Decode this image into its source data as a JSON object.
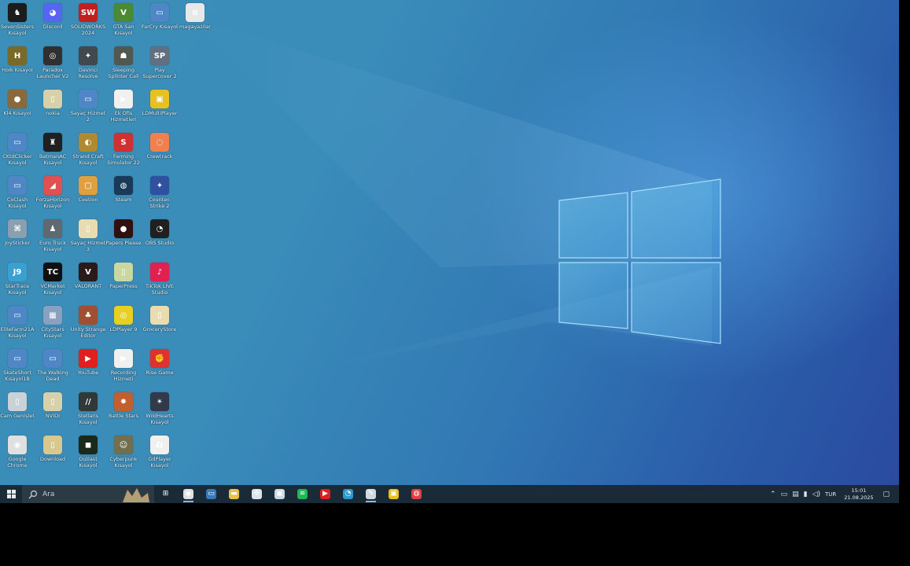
{
  "desktop": {
    "columns": [
      [
        {
          "label": "SevenSisters Kısayol",
          "color": "#1c1c1c",
          "glyph": "♞"
        },
        {
          "label": "Hoik Kısayol",
          "color": "#7a6a2a",
          "glyph": "H"
        },
        {
          "label": "Kl4 Kısayol",
          "color": "#8a6a3a",
          "glyph": "●"
        },
        {
          "label": "CKtdClicker Kısayol",
          "color": "#4f86c6",
          "glyph": "▭"
        },
        {
          "label": "CoClash Kısayol",
          "color": "#4f86c6",
          "glyph": "▭"
        },
        {
          "label": "JoySticker",
          "color": "#8aa0b0",
          "glyph": "⌘"
        },
        {
          "label": "StarTrace Kısayol",
          "color": "#3aa0d0",
          "glyph": "J9"
        },
        {
          "label": "EliteFarm21A Kısayol",
          "color": "#4f86c6",
          "glyph": "▭"
        },
        {
          "label": "SkateShort Kısayol1B",
          "color": "#4f86c6",
          "glyph": "▭"
        },
        {
          "label": "Cam Genişlet",
          "color": "#c8d2d8",
          "glyph": "▯"
        },
        {
          "label": "Google Chrome",
          "color": "#e0e0e0",
          "glyph": "◉"
        }
      ],
      [
        {
          "label": "Discord",
          "color": "#5865f2",
          "glyph": "◕"
        },
        {
          "label": "Paradox Launcher V2",
          "color": "#303030",
          "glyph": "◎"
        },
        {
          "label": "nokia",
          "color": "#d8d0a8",
          "glyph": "▯"
        },
        {
          "label": "BatmanAC Kısayol",
          "color": "#202020",
          "glyph": "♜"
        },
        {
          "label": "ForzaHorizon Kısayol",
          "color": "#e05050",
          "glyph": "◢"
        },
        {
          "label": "Euro Truck Kısayol",
          "color": "#606870",
          "glyph": "♟"
        },
        {
          "label": "VCMarket Kısayol",
          "color": "#101010",
          "glyph": "TC"
        },
        {
          "label": "CityStars Kısayol",
          "color": "#8aa0c0",
          "glyph": "▦"
        },
        {
          "label": "The Walking Dead",
          "color": "#4f86c6",
          "glyph": "▭"
        },
        {
          "label": "NVIDI",
          "color": "#d8d0a8",
          "glyph": "▯"
        },
        {
          "label": "Download",
          "color": "#d8c890",
          "glyph": "▯"
        }
      ],
      [
        {
          "label": "SOLIDWORKS 2024",
          "color": "#c02020",
          "glyph": "SW"
        },
        {
          "label": "Davinci Resolve",
          "color": "#404850",
          "glyph": "✦"
        },
        {
          "label": "Sayaç Hizmet 2",
          "color": "#4f86c6",
          "glyph": "▭"
        },
        {
          "label": "Strand Craft Kısayol",
          "color": "#b08a30",
          "glyph": "◐"
        },
        {
          "label": "Ceetion",
          "color": "#e0a040",
          "glyph": "▢"
        },
        {
          "label": "Sayaç Hizmet 3",
          "color": "#e8dcb0",
          "glyph": "▯"
        },
        {
          "label": "VALORANT",
          "color": "#2a1a1a",
          "glyph": "V"
        },
        {
          "label": "Unity Strange Editor",
          "color": "#a05030",
          "glyph": "♣"
        },
        {
          "label": "YouTube",
          "color": "#e02020",
          "glyph": "▶"
        },
        {
          "label": "Stellaris Kısayol",
          "color": "#303838",
          "glyph": "//"
        },
        {
          "label": "Outlast Kısayol",
          "color": "#1a2a1a",
          "glyph": "◼"
        }
      ],
      [
        {
          "label": "GTA San Kısayol",
          "color": "#4a8a30",
          "glyph": "V"
        },
        {
          "label": "Sleeping Splinter Cell",
          "color": "#505850",
          "glyph": "☗"
        },
        {
          "label": "Ek Ofis Hizmetleri",
          "color": "#f0f0f0",
          "glyph": "▶"
        },
        {
          "label": "Farming Simulator 22",
          "color": "#d03030",
          "glyph": "S"
        },
        {
          "label": "Steam",
          "color": "#1a3a5a",
          "glyph": "◍"
        },
        {
          "label": "Papers Please",
          "color": "#301010",
          "glyph": "●"
        },
        {
          "label": "PaperPress",
          "color": "#c8d8a0",
          "glyph": "▯"
        },
        {
          "label": "LDPlayer 9",
          "color": "#e8d020",
          "glyph": "◎"
        },
        {
          "label": "Recording Hizmeti",
          "color": "#f0f0f0",
          "glyph": "▶"
        },
        {
          "label": "Battle Stars",
          "color": "#c06030",
          "glyph": "✸"
        },
        {
          "label": "Cyberpunk Kısayol",
          "color": "#707050",
          "glyph": "☺"
        }
      ],
      [
        {
          "label": "FarCry Kısayol",
          "color": "#4f86c6",
          "glyph": "▭"
        },
        {
          "label": "Play Supercover 2",
          "color": "#607080",
          "glyph": "SP"
        },
        {
          "label": "LDMultiPlayer",
          "color": "#e8c020",
          "glyph": "▣"
        },
        {
          "label": "Crewtrack",
          "color": "#f08050",
          "glyph": "◌"
        },
        {
          "label": "Counter-Strike 2",
          "color": "#3050a0",
          "glyph": "✦"
        },
        {
          "label": "OBS Studio",
          "color": "#202020",
          "glyph": "◔"
        },
        {
          "label": "TikTok LIVE Studio",
          "color": "#e02050",
          "glyph": "♪"
        },
        {
          "label": "GroceryStore",
          "color": "#e8dcb0",
          "glyph": "▯"
        },
        {
          "label": "Rise Game",
          "color": "#e03030",
          "glyph": "✊"
        },
        {
          "label": "WildHearts Kısayol",
          "color": "#303a48",
          "glyph": "✴"
        },
        {
          "label": "GdPlayer Kısayol",
          "color": "#f0f0f0",
          "glyph": "Ω"
        }
      ],
      [
        {
          "label": "magayazilar",
          "color": "#e8e8e8",
          "glyph": "≡"
        }
      ]
    ]
  },
  "taskbar": {
    "search_placeholder": "Ara",
    "apps": [
      {
        "name": "task-view",
        "color": "#1a2a36",
        "glyph": "⊞",
        "open": false
      },
      {
        "name": "chrome",
        "color": "#e0e0e0",
        "glyph": "◉",
        "open": true
      },
      {
        "name": "monitor",
        "color": "#3a7ab8",
        "glyph": "▭",
        "open": false
      },
      {
        "name": "file-explorer",
        "color": "#e8c050",
        "glyph": "▬",
        "open": false
      },
      {
        "name": "chatgpt",
        "color": "#dde5ea",
        "glyph": "✣",
        "open": false
      },
      {
        "name": "store",
        "color": "#c8d8e8",
        "glyph": "▣",
        "open": false
      },
      {
        "name": "spotify",
        "color": "#1db954",
        "glyph": "≋",
        "open": false
      },
      {
        "name": "youtube",
        "color": "#e02020",
        "glyph": "▶",
        "open": false
      },
      {
        "name": "edge",
        "color": "#2a9ad0",
        "glyph": "◔",
        "open": false
      },
      {
        "name": "paint",
        "color": "#d0d8e0",
        "glyph": "✎",
        "open": true
      },
      {
        "name": "ldplayer",
        "color": "#e8c020",
        "glyph": "▣",
        "open": false
      },
      {
        "name": "recorder",
        "color": "#e04040",
        "glyph": "◍",
        "open": false
      }
    ],
    "tray": {
      "language": "TUR",
      "time": "15:01",
      "date": "21.08.2025"
    }
  }
}
